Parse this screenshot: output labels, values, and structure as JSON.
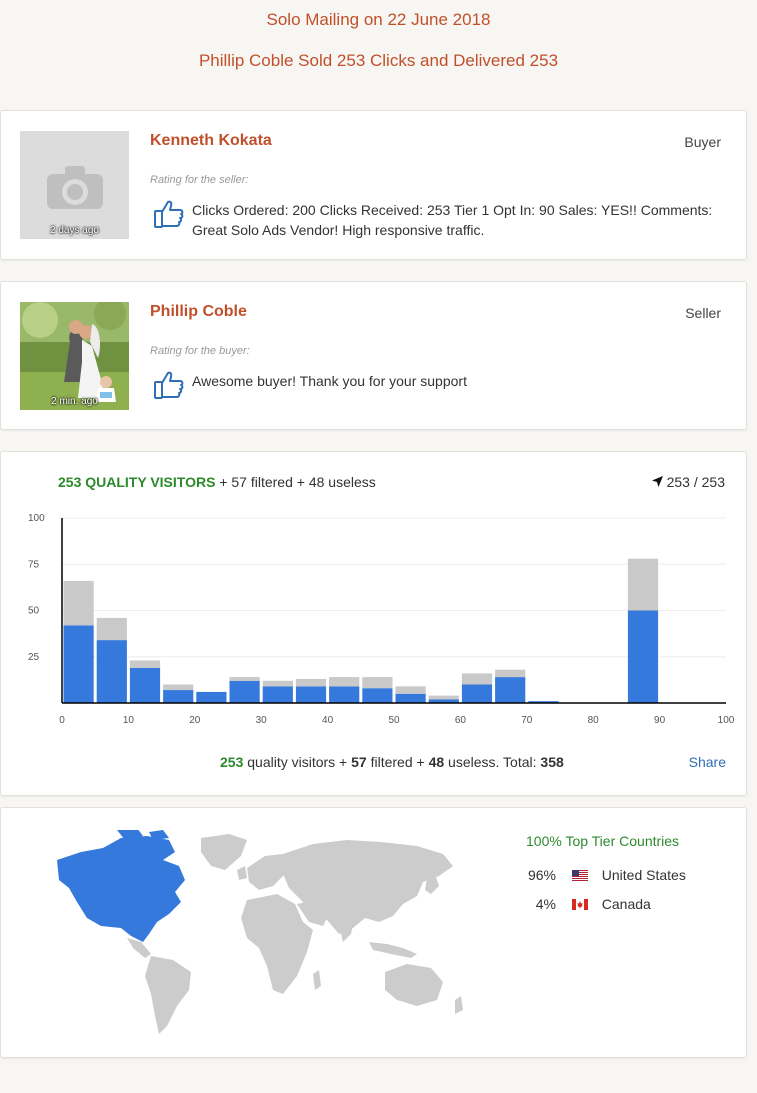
{
  "header": {
    "title": "Solo Mailing on 22 June 2018",
    "subtitle": "Phillip Coble Sold 253 Clicks and Delivered 253"
  },
  "reviews": [
    {
      "name": "Kenneth Kokata",
      "role": "Buyer",
      "photo_label": "2 days ago",
      "rating_label": "Rating for the seller:",
      "comment": "Clicks Ordered: 200 Clicks Received: 253 Tier 1 Opt In: 90 Sales: YES!! Comments: Great Solo Ads Vendor! High responsive traffic."
    },
    {
      "name": "Phillip Coble",
      "role": "Seller",
      "photo_label": "2 min. ago",
      "rating_label": "Rating for the buyer:",
      "comment": "Awesome buyer! Thank you for your support"
    }
  ],
  "stats": {
    "quality_count": "253",
    "quality_label": "QUALITY VISITORS",
    "filtered_text": "+ 57 filtered + 48 useless",
    "delivered": "253 / 253",
    "footer": {
      "quality": "253",
      "quality_text": "quality visitors +",
      "filtered": "57",
      "filtered_text": "filtered +",
      "useless": "48",
      "useless_text": "useless. Total:",
      "total": "358"
    },
    "share_label": "Share"
  },
  "chart_data": {
    "type": "bar",
    "stacked": true,
    "x_ticks": [
      0,
      10,
      20,
      30,
      40,
      50,
      60,
      70,
      80,
      90,
      100
    ],
    "y_ticks": [
      25,
      50,
      75,
      100
    ],
    "ylim": [
      0,
      100
    ],
    "xlim": [
      0,
      100
    ],
    "grid": true,
    "categories": [
      2.5,
      7.5,
      12.5,
      17.5,
      22.5,
      27.5,
      32.5,
      37.5,
      42.5,
      47.5,
      52.5,
      57.5,
      62.5,
      67.5,
      72.5,
      87.5
    ],
    "series": [
      {
        "values": [
          42,
          34,
          19,
          7,
          6,
          12,
          9,
          9,
          9,
          8,
          5,
          2,
          10,
          14,
          1,
          50
        ]
      },
      {
        "values": [
          24,
          12,
          4,
          3,
          0,
          2,
          3,
          4,
          5,
          6,
          4,
          2,
          6,
          4,
          0,
          28
        ]
      }
    ],
    "colors": [
      "#3579dc",
      "#c9c9c9"
    ]
  },
  "geo": {
    "title": "100% Top Tier Countries",
    "countries": [
      {
        "pct": "96%",
        "name": "United States",
        "flag": "us-flag"
      },
      {
        "pct": "4%",
        "name": "Canada",
        "flag": "ca-flag"
      }
    ],
    "highlight_color": "#3579dc",
    "base_color": "#cccccc"
  }
}
